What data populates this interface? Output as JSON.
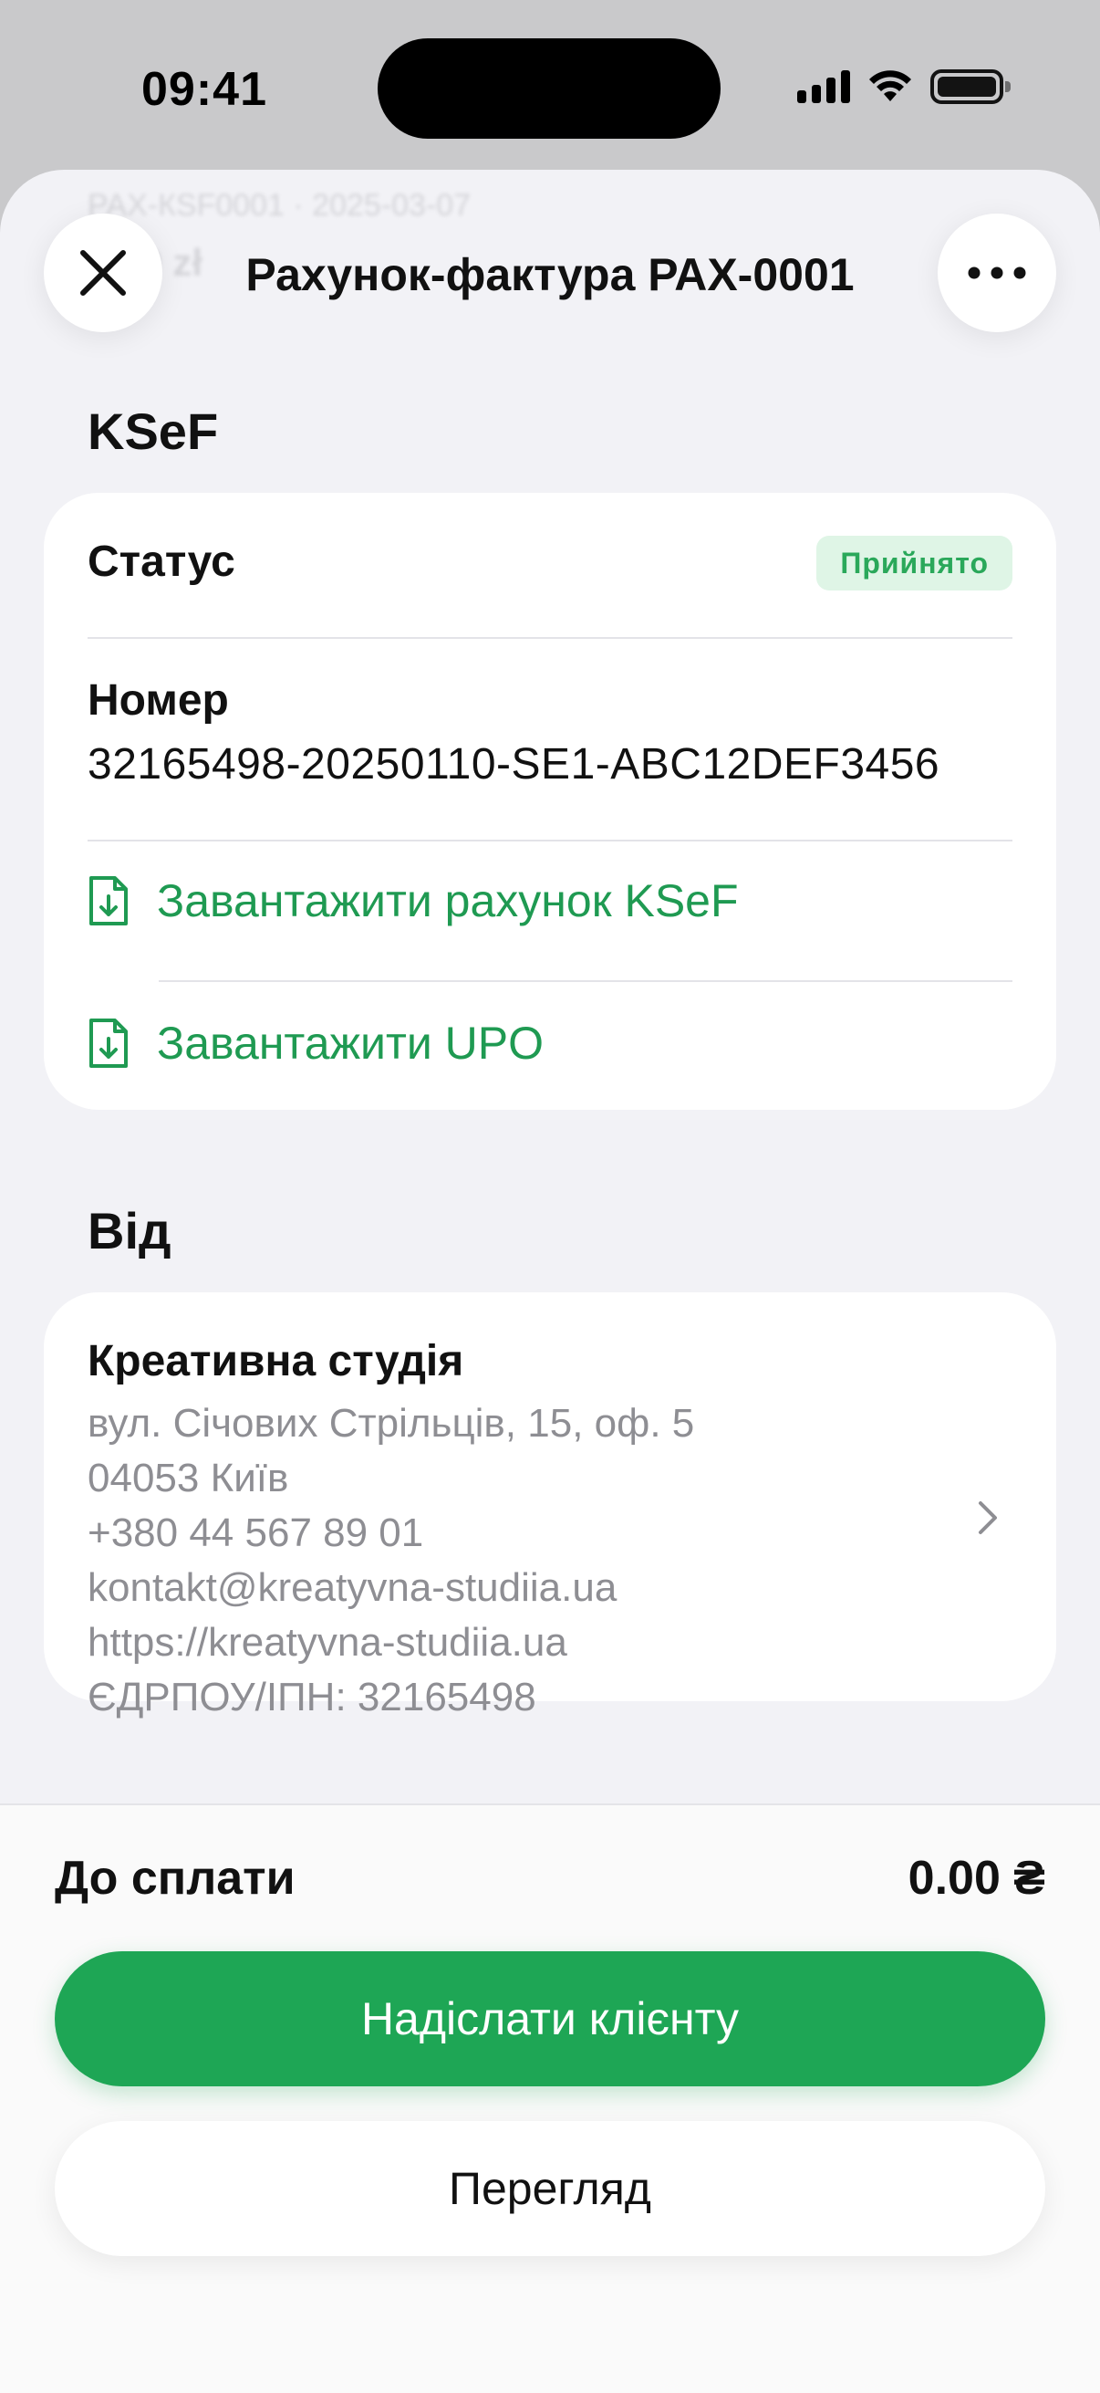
{
  "status_bar": {
    "time": "09:41"
  },
  "ghost_header": {
    "line1": "РАХ-КSF0001 · 2025-03-07",
    "line2": "0,00 zł"
  },
  "nav": {
    "title": "Рахунок-фактура РАХ-0001"
  },
  "ksef": {
    "section_title": "KSeF",
    "status_label": "Статус",
    "status_badge": "Прийнято",
    "number_label": "Номер",
    "number_value": "32165498-20250110-SE1-ABC12DEF3456",
    "download_invoice": "Завантажити рахунок KSeF",
    "download_upo": "Завантажити UPO"
  },
  "from": {
    "section_title": "Від",
    "company_name": "Креативна студія",
    "address": "вул. Січових Стрільців, 15, оф. 5",
    "city": "04053 Київ",
    "phone": "+380 44 567 89 01",
    "email": "kontakt@kreatyvna-studiia.ua",
    "website": "https://kreatyvna-studiia.ua",
    "tax_id": "ЄДРПОУ/ІПН: 32165498"
  },
  "footer": {
    "due_label": "До сплати",
    "due_amount": "0.00 ₴",
    "send_button": "Надіслати клієнту",
    "preview_button": "Перегляд"
  },
  "colors": {
    "accent": "#1ea655",
    "badge_bg": "#dff5e6",
    "badge_text": "#2aa85a"
  }
}
